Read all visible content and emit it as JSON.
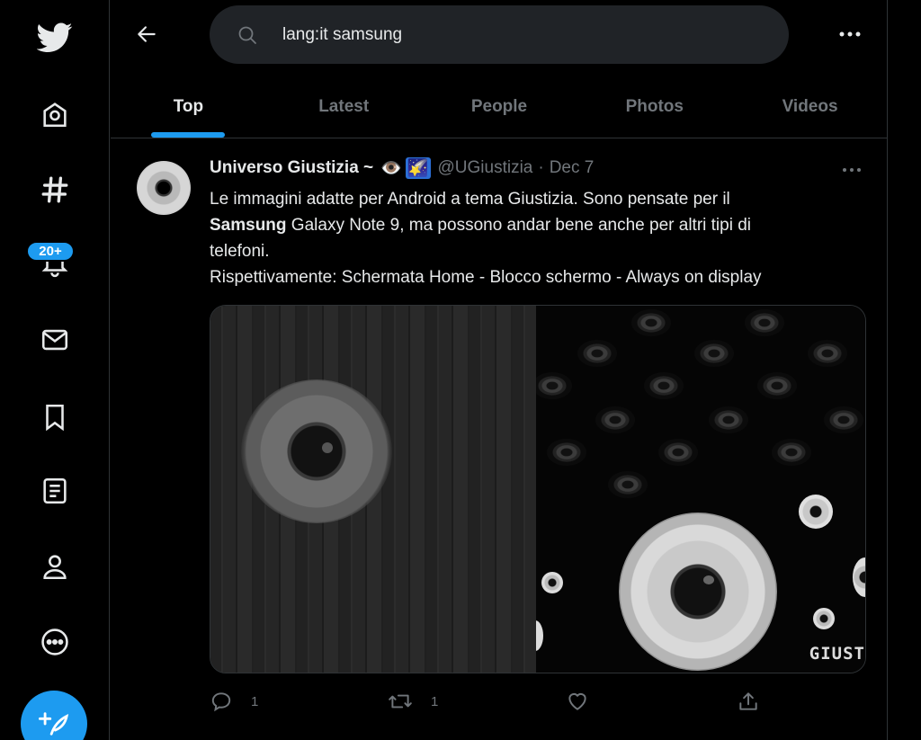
{
  "sidebar": {
    "notifications_badge": "20+",
    "icons": [
      "twitter-logo-icon",
      "home-icon",
      "explore-hashtag-icon",
      "notifications-bell-icon",
      "messages-mail-icon",
      "bookmarks-icon",
      "lists-icon",
      "profile-icon",
      "more-icon",
      "compose-tweet-icon"
    ]
  },
  "header": {
    "search_value": "lang:it samsung"
  },
  "tabs": [
    {
      "label": "Top",
      "active": true
    },
    {
      "label": "Latest",
      "active": false
    },
    {
      "label": "People",
      "active": false
    },
    {
      "label": "Photos",
      "active": false
    },
    {
      "label": "Videos",
      "active": false
    }
  ],
  "tweet": {
    "name": "Universo Giustizia ~",
    "emoji": [
      "👁️",
      "🌠"
    ],
    "handle": "@UGiustizia",
    "separator": "·",
    "date": "Dec 7",
    "text_line1": "Le immagini adatte per Android a tema Giustizia. Sono pensate per il",
    "text_bold": "Samsung",
    "text_line2": " Galaxy Note 9, ma possono andar bene anche per altri tipi di",
    "text_line3": "telefoni.",
    "text_line4": "Rispettivamente: Schermata Home - Blocco schermo - Always on display",
    "watermark": "GIUST",
    "reply_count": "1",
    "retweet_count": "1",
    "colors": {
      "accent": "#1d9bf0",
      "muted": "#71767b",
      "text": "#e7e9ea",
      "border": "#2f3336"
    }
  }
}
